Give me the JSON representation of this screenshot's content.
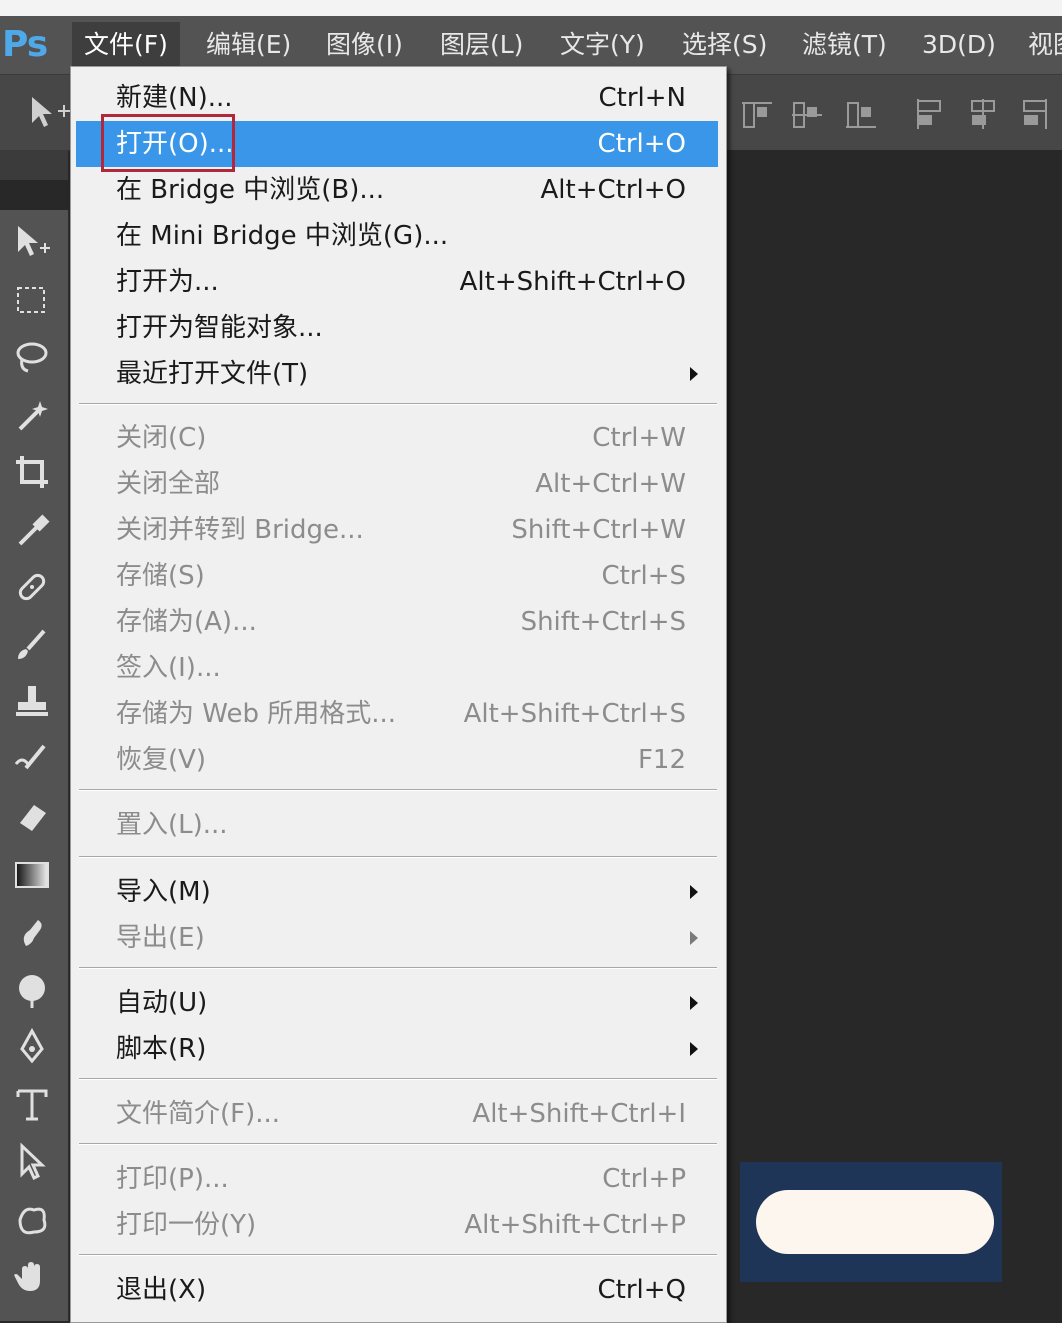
{
  "app": {
    "logo": "Ps"
  },
  "menubar": {
    "items": [
      {
        "label": "文件(F)",
        "active": true
      },
      {
        "label": "编辑(E)"
      },
      {
        "label": "图像(I)"
      },
      {
        "label": "图层(L)"
      },
      {
        "label": "文字(Y)"
      },
      {
        "label": "选择(S)"
      },
      {
        "label": "滤镜(T)"
      },
      {
        "label": "3D(D)"
      },
      {
        "label": "视图"
      }
    ]
  },
  "file_menu": {
    "groups": [
      [
        {
          "label": "新建(N)...",
          "shortcut": "Ctrl+N",
          "enabled": true
        },
        {
          "label": "打开(O)...",
          "shortcut": "Ctrl+O",
          "enabled": true,
          "highlighted": true
        },
        {
          "label": "在 Bridge 中浏览(B)...",
          "shortcut": "Alt+Ctrl+O",
          "enabled": true
        },
        {
          "label": "在 Mini Bridge 中浏览(G)...",
          "shortcut": "",
          "enabled": true
        },
        {
          "label": "打开为...",
          "shortcut": "Alt+Shift+Ctrl+O",
          "enabled": true
        },
        {
          "label": "打开为智能对象...",
          "shortcut": "",
          "enabled": true
        },
        {
          "label": "最近打开文件(T)",
          "shortcut": "",
          "enabled": true,
          "submenu": true
        }
      ],
      [
        {
          "label": "关闭(C)",
          "shortcut": "Ctrl+W",
          "enabled": false
        },
        {
          "label": "关闭全部",
          "shortcut": "Alt+Ctrl+W",
          "enabled": false
        },
        {
          "label": "关闭并转到 Bridge...",
          "shortcut": "Shift+Ctrl+W",
          "enabled": false
        },
        {
          "label": "存储(S)",
          "shortcut": "Ctrl+S",
          "enabled": false
        },
        {
          "label": "存储为(A)...",
          "shortcut": "Shift+Ctrl+S",
          "enabled": false
        },
        {
          "label": "签入(I)...",
          "shortcut": "",
          "enabled": false
        },
        {
          "label": "存储为 Web 所用格式...",
          "shortcut": "Alt+Shift+Ctrl+S",
          "enabled": false
        },
        {
          "label": "恢复(V)",
          "shortcut": "F12",
          "enabled": false
        }
      ],
      [
        {
          "label": "置入(L)...",
          "shortcut": "",
          "enabled": false
        }
      ],
      [
        {
          "label": "导入(M)",
          "shortcut": "",
          "enabled": true,
          "submenu": true
        },
        {
          "label": "导出(E)",
          "shortcut": "",
          "enabled": false,
          "submenu": true
        }
      ],
      [
        {
          "label": "自动(U)",
          "shortcut": "",
          "enabled": true,
          "submenu": true
        },
        {
          "label": "脚本(R)",
          "shortcut": "",
          "enabled": true,
          "submenu": true
        }
      ],
      [
        {
          "label": "文件简介(F)...",
          "shortcut": "Alt+Shift+Ctrl+I",
          "enabled": false
        }
      ],
      [
        {
          "label": "打印(P)...",
          "shortcut": "Ctrl+P",
          "enabled": false
        },
        {
          "label": "打印一份(Y)",
          "shortcut": "Alt+Shift+Ctrl+P",
          "enabled": false
        }
      ],
      [
        {
          "label": "退出(X)",
          "shortcut": "Ctrl+Q",
          "enabled": true
        }
      ]
    ]
  },
  "tools": [
    "move-tool-icon",
    "marquee-tool-icon",
    "lasso-tool-icon",
    "magic-wand-icon",
    "crop-tool-icon",
    "eyedropper-icon",
    "healing-brush-icon",
    "brush-tool-icon",
    "clone-stamp-icon",
    "history-brush-icon",
    "eraser-icon",
    "gradient-icon",
    "smudge-icon",
    "dodge-icon",
    "pen-tool-icon",
    "type-tool-icon",
    "path-selection-icon",
    "shape-tool-icon",
    "hand-tool-icon"
  ],
  "colors": {
    "highlight": "#3a96e8",
    "menu_bg": "#f0f0f0",
    "annotation": "#b0283a",
    "ui_dark": "#535353"
  }
}
